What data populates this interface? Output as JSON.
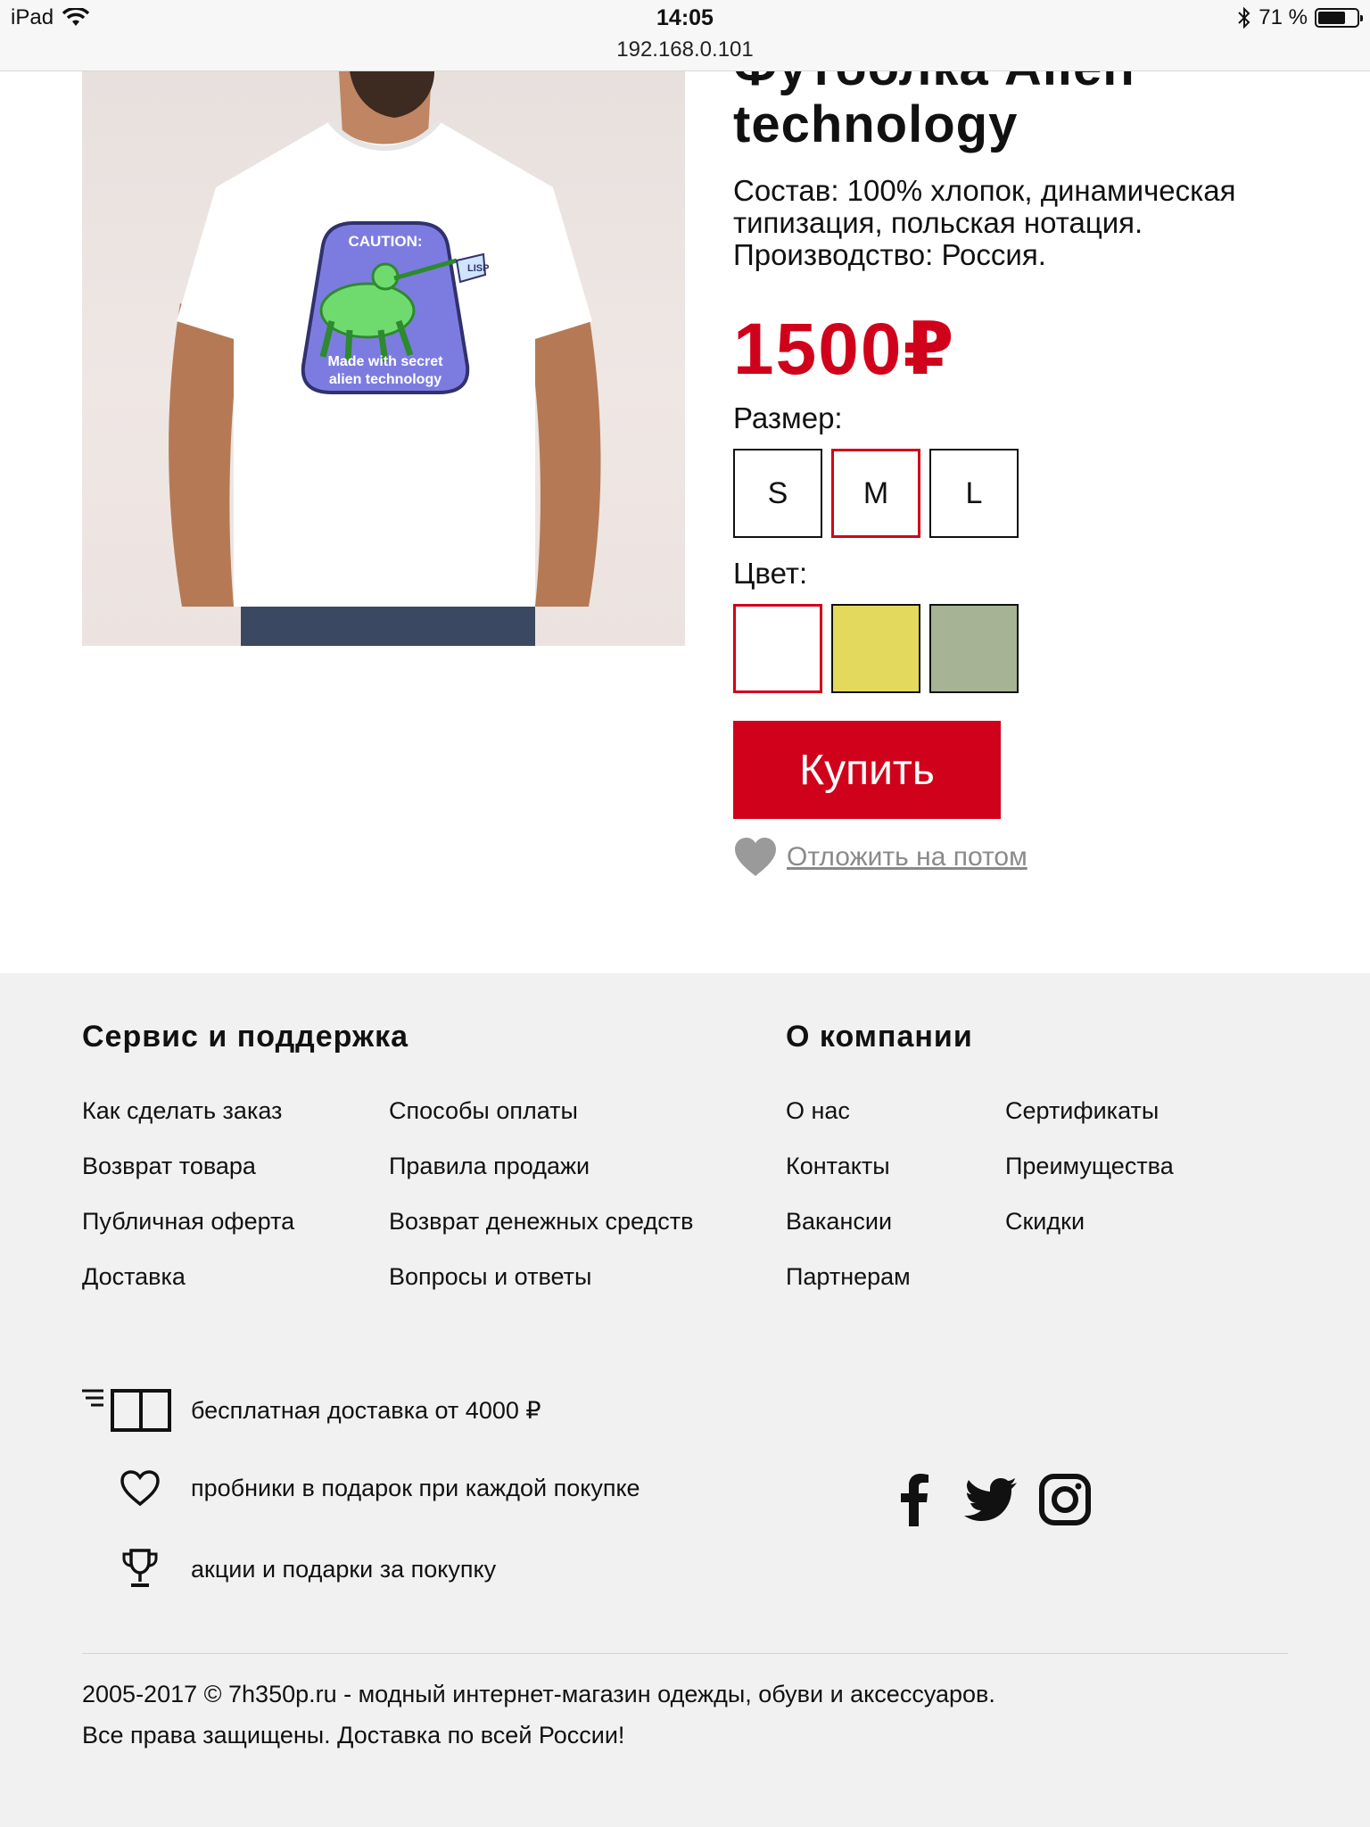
{
  "status_bar": {
    "device": "iPad",
    "time": "14:05",
    "url": "192.168.0.101",
    "battery": "71 %",
    "battery_level": 0.71
  },
  "product": {
    "title": "Футболка Alien technology",
    "description": "Состав: 100% хлопок, динамическая типизация, польская нотация. Производство: Россия.",
    "price": "1500₽",
    "size_label": "Размер:",
    "sizes": [
      "S",
      "M",
      "L"
    ],
    "selected_size": "M",
    "color_label": "Цвет:",
    "colors": [
      "#ffffff",
      "#e3d95c",
      "#a6b394"
    ],
    "selected_color": "#ffffff",
    "buy_label": "Купить",
    "later_label": "Отложить на потом",
    "print": {
      "caution": "CAUTION:",
      "line1": "Made with secret",
      "line2": "alien technology",
      "flag": "LISP"
    }
  },
  "footer": {
    "service_heading": "Сервис и поддержка",
    "company_heading": "О компании",
    "service_col1": [
      "Как сделать заказ",
      "Возврат товара",
      "Публичная оферта",
      "Доставка"
    ],
    "service_col2": [
      "Способы оплаты",
      "Правила продажи",
      "Возврат денежных средств",
      "Вопросы и ответы"
    ],
    "company_col1": [
      "О нас",
      "Контакты",
      "Вакансии",
      "Партнерам"
    ],
    "company_col2": [
      "Сертификаты",
      "Преимущества",
      "Скидки"
    ],
    "features": [
      {
        "icon": "delivery-truck-icon",
        "text": "бесплатная доставка от 4000 ₽"
      },
      {
        "icon": "heart-outline-icon",
        "text": "пробники в подарок при каждой покупке"
      },
      {
        "icon": "trophy-icon",
        "text": "акции и подарки за покупку"
      }
    ],
    "social": [
      "facebook-icon",
      "twitter-icon",
      "instagram-icon"
    ],
    "copyright_line1": "2005-2017 © 7h350p.ru - модный интернет-магазин одежды, обуви и аксессуаров.",
    "copyright_line2": "Все права защищены. Доставка по всей России!"
  },
  "colors": {
    "accent": "#d0021b",
    "footer_bg": "#f1f1f1",
    "muted": "#8a8a8a"
  }
}
